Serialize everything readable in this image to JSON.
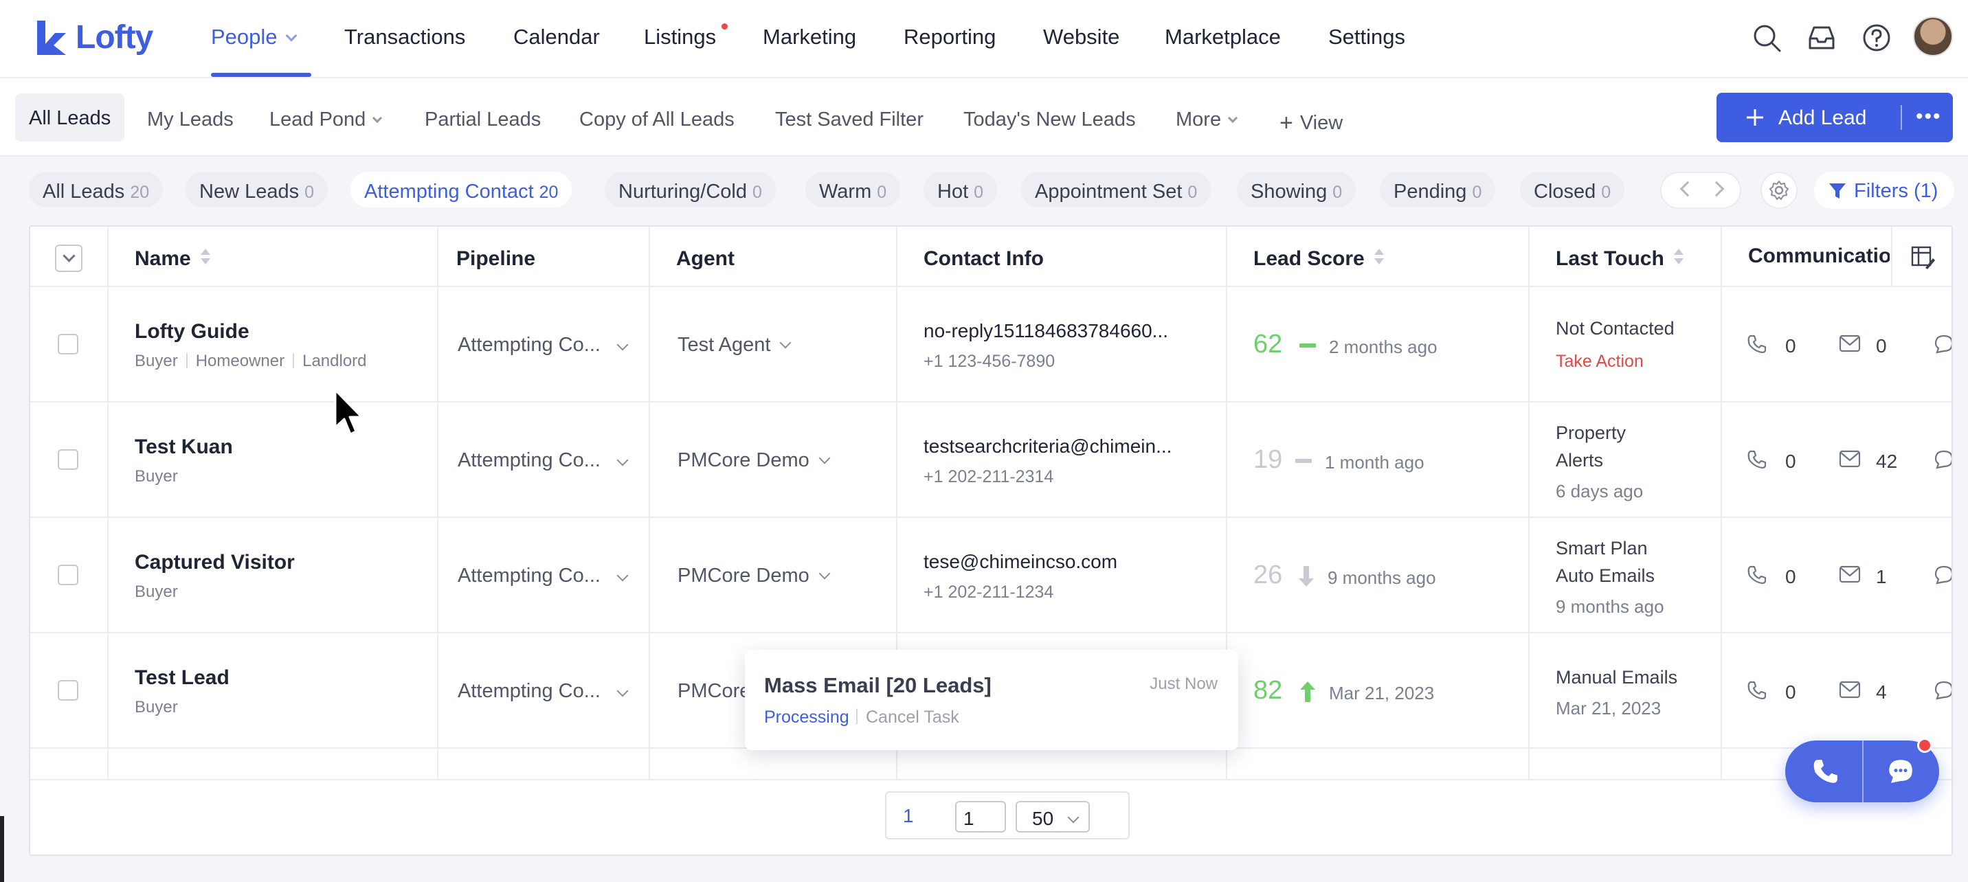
{
  "app": {
    "name": "Lofty",
    "brand_color": "#3e5de0"
  },
  "nav": {
    "items": [
      "People",
      "Transactions",
      "Calendar",
      "Listings",
      "Marketing",
      "Reporting",
      "Website",
      "Marketplace",
      "Settings"
    ],
    "active": "People"
  },
  "subtabs": {
    "items": [
      "All Leads",
      "My Leads",
      "Lead Pond",
      "Partial Leads",
      "Copy of All Leads",
      "Test Saved Filter",
      "Today's New Leads",
      "More",
      "View"
    ],
    "active": "All Leads",
    "add_lead": "Add Lead"
  },
  "stages": [
    {
      "label": "All Leads",
      "count": "20"
    },
    {
      "label": "New Leads",
      "count": "0"
    },
    {
      "label": "Attempting Contact",
      "count": "20"
    },
    {
      "label": "Nurturing/Cold",
      "count": "0"
    },
    {
      "label": "Warm",
      "count": "0"
    },
    {
      "label": "Hot",
      "count": "0"
    },
    {
      "label": "Appointment Set",
      "count": "0"
    },
    {
      "label": "Showing",
      "count": "0"
    },
    {
      "label": "Pending",
      "count": "0"
    },
    {
      "label": "Closed",
      "count": "0"
    }
  ],
  "active_stage": "Attempting Contact",
  "filters_label": "Filters (1)",
  "table": {
    "columns": [
      "Name",
      "Pipeline",
      "Agent",
      "Contact Info",
      "Lead Score",
      "Last Touch",
      "Communication"
    ],
    "rows": [
      {
        "name": "Lofty Guide",
        "tags": [
          "Buyer",
          "Homeowner",
          "Landlord"
        ],
        "pipeline": "Attempting Co...",
        "agent": "Test Agent",
        "email": "no-reply151184683784660...",
        "phone": "+1 123-456-7890",
        "score": "62",
        "score_trend": "flat",
        "score_color": "#6fcf6c",
        "score_time": "2 months ago",
        "touch_line1": "Not Contacted",
        "touch_line2": "",
        "touch_sub": "Take Action",
        "calls": "0",
        "emails": "0"
      },
      {
        "name": "Test Kuan",
        "tags": [
          "Buyer"
        ],
        "pipeline": "Attempting Co...",
        "agent": "PMCore Demo",
        "email": "testsearchcriteria@chimein...",
        "phone": "+1 202-211-2314",
        "score": "19",
        "score_trend": "flat",
        "score_color": "#c7cad3",
        "score_time": "1 month ago",
        "touch_line1": "Property",
        "touch_line2": "Alerts",
        "touch_sub": "6 days ago",
        "calls": "0",
        "emails": "42"
      },
      {
        "name": "Captured Visitor",
        "tags": [
          "Buyer"
        ],
        "pipeline": "Attempting Co...",
        "agent": "PMCore Demo",
        "email": "tese@chimeincso.com",
        "phone": "+1 202-211-1234",
        "score": "26",
        "score_trend": "down",
        "score_color": "#c7cad3",
        "score_time": "9 months ago",
        "touch_line1": "Smart Plan",
        "touch_line2": "Auto Emails",
        "touch_sub": "9 months ago",
        "calls": "0",
        "emails": "1"
      },
      {
        "name": "Test Lead",
        "tags": [
          "Buyer"
        ],
        "pipeline": "Attempting Co...",
        "agent": "PMCore",
        "email": "",
        "phone": "",
        "score": "82",
        "score_trend": "up",
        "score_color": "#6fcf6c",
        "score_time": "Mar 21, 2023",
        "touch_line1": "Manual Emails",
        "touch_line2": "",
        "touch_sub": "Mar 21, 2023",
        "calls": "0",
        "emails": "4"
      }
    ]
  },
  "pagination": {
    "current": "1",
    "page_input": "1",
    "page_size": "50"
  },
  "toast": {
    "title": "Mass Email [20 Leads]",
    "time": "Just Now",
    "status": "Processing",
    "cancel": "Cancel Task"
  },
  "icons": {
    "search": "search-icon",
    "inbox": "inbox-icon",
    "help": "help-icon",
    "phone": "phone-icon",
    "mail": "mail-icon",
    "chat": "chat-icon",
    "gear": "gear-icon",
    "filter": "filter-icon",
    "columns": "table-columns-icon"
  }
}
